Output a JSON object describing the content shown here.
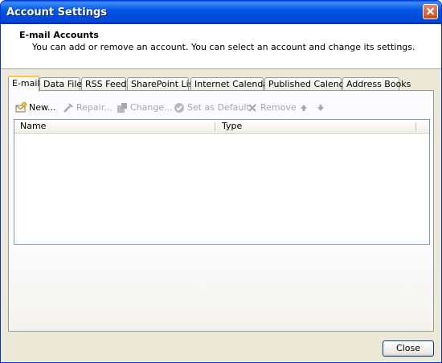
{
  "window": {
    "title": "Account Settings"
  },
  "header": {
    "title": "E-mail Accounts",
    "description": "You can add or remove an account. You can select an account and change its settings."
  },
  "tabs": [
    {
      "label": "E-mail",
      "active": true
    },
    {
      "label": "Data Files"
    },
    {
      "label": "RSS Feeds"
    },
    {
      "label": "SharePoint Lists"
    },
    {
      "label": "Internet Calendars"
    },
    {
      "label": "Published Calendars"
    },
    {
      "label": "Address Books"
    }
  ],
  "toolbar": {
    "new_label": "New...",
    "repair_label": "Repair...",
    "change_label": "Change...",
    "set_default_label": "Set as Default",
    "remove_label": "Remove"
  },
  "list": {
    "columns": [
      "Name",
      "Type"
    ],
    "rows": []
  },
  "footer": {
    "close_label": "Close"
  },
  "icons": {
    "new": "new-account-icon",
    "repair": "repair-icon",
    "change": "change-icon",
    "set_default": "set-default-icon",
    "remove": "remove-icon",
    "move_up": "arrow-up-icon",
    "move_down": "arrow-down-icon"
  },
  "colors": {
    "title_bar": "#0055e5",
    "active_tab_highlight": "#ffc83c",
    "dialog_bg": "#ece9d8"
  }
}
